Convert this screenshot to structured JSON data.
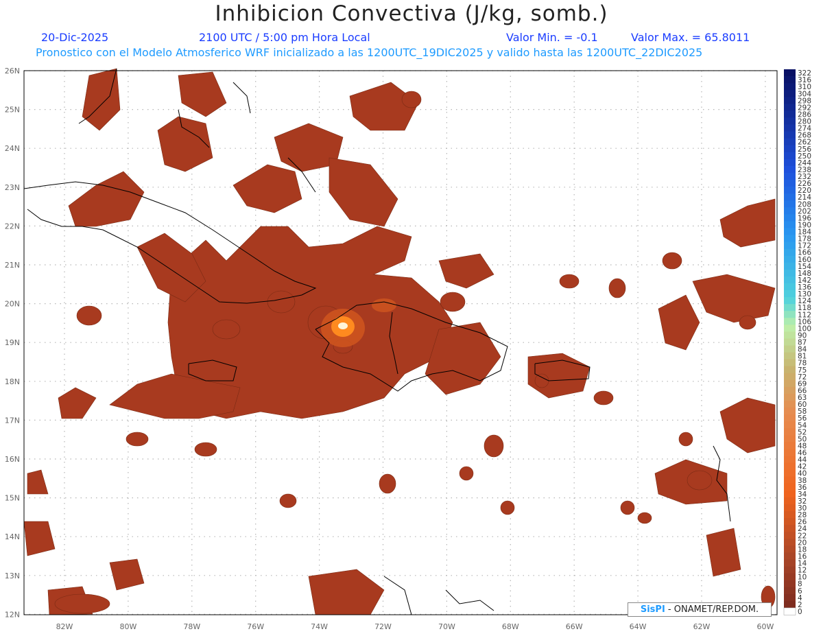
{
  "header": {
    "title": "Inhibicion Convectiva (J/kg, somb.)",
    "date": "20-Dic-2025",
    "time": "2100 UTC / 5:00 pm Hora Local",
    "valor_min": "Valor Min. = -0.1",
    "valor_max": "Valor Max. = 65.8011",
    "subtitle": "Pronostico con el Modelo Atmosferico WRF inicializado a las 1200UTC_19DIC2025 y valido hasta las  1200UTC_22DIC2025"
  },
  "map": {
    "lat_labels": [
      "26N",
      "25N",
      "24N",
      "23N",
      "22N",
      "21N",
      "20N",
      "19N",
      "18N",
      "17N",
      "16N",
      "15N",
      "14N",
      "13N",
      "12N"
    ],
    "lon_labels": [
      "82W",
      "80W",
      "78W",
      "76W",
      "74W",
      "72W",
      "70W",
      "68W",
      "66W",
      "64W",
      "62W",
      "60W"
    ],
    "field_color": "#a83a1f",
    "coast_color": "#000000",
    "grid_color": "#b5b5b5"
  },
  "colorbar": {
    "labels": [
      "322",
      "316",
      "310",
      "304",
      "298",
      "292",
      "286",
      "280",
      "274",
      "268",
      "262",
      "256",
      "250",
      "244",
      "238",
      "232",
      "226",
      "220",
      "214",
      "208",
      "202",
      "196",
      "190",
      "184",
      "178",
      "172",
      "166",
      "160",
      "154",
      "148",
      "142",
      "136",
      "130",
      "124",
      "118",
      "112",
      "106",
      "100",
      "90",
      "87",
      "84",
      "81",
      "78",
      "75",
      "72",
      "69",
      "66",
      "63",
      "60",
      "58",
      "56",
      "54",
      "52",
      "50",
      "48",
      "46",
      "44",
      "42",
      "40",
      "38",
      "36",
      "34",
      "32",
      "30",
      "28",
      "26",
      "24",
      "22",
      "20",
      "18",
      "16",
      "14",
      "12",
      "10",
      "8",
      "6",
      "4",
      "2",
      "0"
    ]
  },
  "credit": {
    "logo": "SisPI",
    "text": " - ONAMET/REP.DOM."
  }
}
